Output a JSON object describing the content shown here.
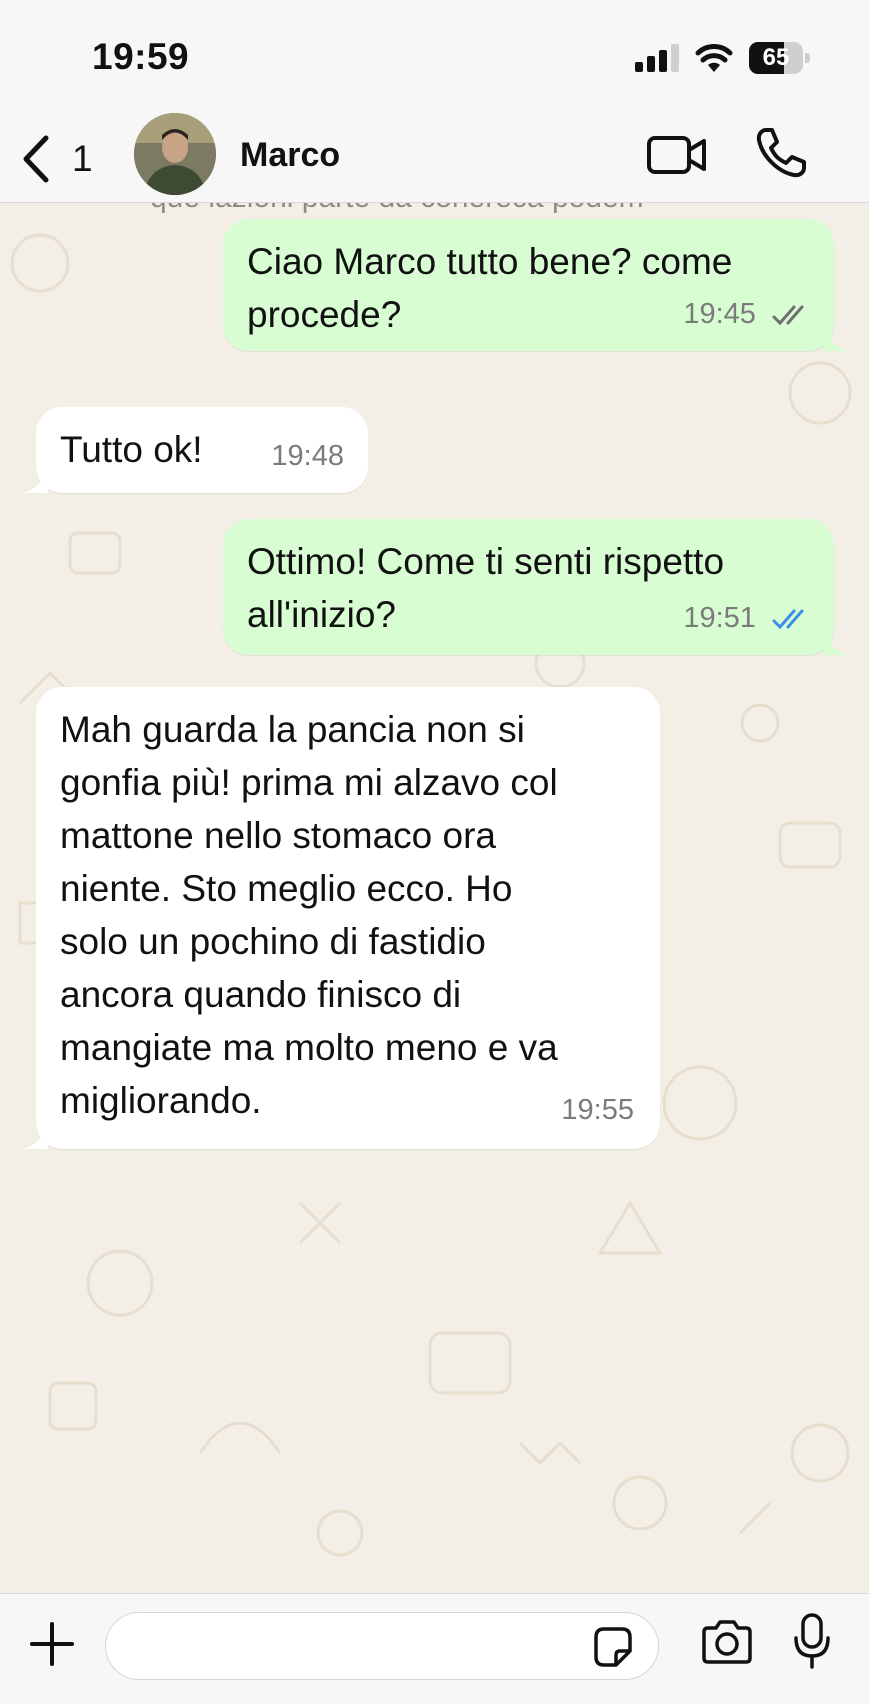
{
  "status_bar": {
    "time": "19:59",
    "battery_level": "65",
    "battery_fraction": 0.65
  },
  "header": {
    "back_count": "1",
    "contact_name": "Marco",
    "icons": [
      "chevron-left-icon",
      "video-call-icon",
      "phone-icon"
    ]
  },
  "chat": {
    "partial_text": "que lazioni parte da cohereca podem",
    "messages": [
      {
        "direction": "outgoing",
        "lines": [
          "Ciao Marco tutto bene? come",
          "procede?"
        ],
        "time": "19:45",
        "status": "delivered"
      },
      {
        "direction": "incoming",
        "lines": [
          "Tutto ok!"
        ],
        "time": "19:48"
      },
      {
        "direction": "outgoing",
        "lines": [
          "Ottimo! Come ti senti rispetto",
          "all'inizio?"
        ],
        "time": "19:51",
        "status": "read"
      },
      {
        "direction": "incoming",
        "lines": [
          "Mah guarda la pancia non si",
          "gonfia più! prima mi alzavo col",
          "mattone nello stomaco ora",
          "niente. Sto meglio ecco. Ho",
          "solo un pochino di fastidio",
          "ancora quando finisco di",
          "mangiate ma molto meno e va",
          "migliorando."
        ],
        "time": "19:55"
      }
    ]
  },
  "composer": {
    "placeholder": "",
    "icons": [
      "plus-icon",
      "sticker-icon",
      "camera-icon",
      "microphone-icon"
    ]
  },
  "colors": {
    "outgoing_bubble": "#d9fdd3",
    "incoming_bubble": "#ffffff",
    "read_ticks": "#3c8ee8",
    "delivered_ticks": "#6f6f6f",
    "wallpaper": "#f4efe6"
  }
}
